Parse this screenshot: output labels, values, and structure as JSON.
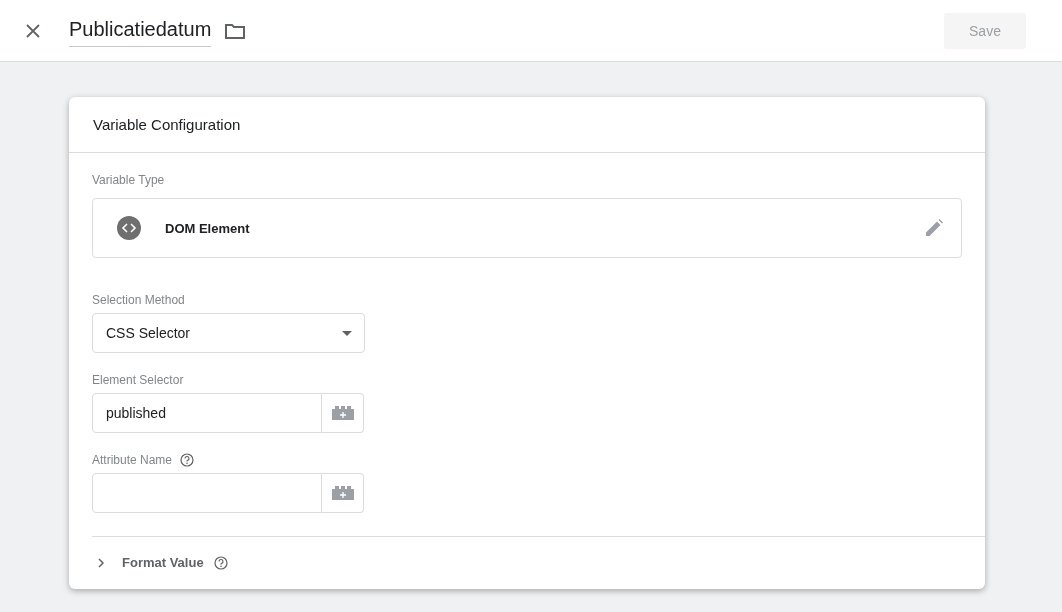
{
  "header": {
    "title": "Publicatiedatum",
    "save_button": {
      "label": "Save",
      "disabled": true
    }
  },
  "card": {
    "title": "Variable Configuration",
    "variable_type": {
      "label": "Variable Type",
      "value": "DOM Element"
    },
    "selection_method": {
      "label": "Selection Method",
      "value": "CSS Selector"
    },
    "fields": [
      {
        "label": "Element Selector",
        "value": "published",
        "help": false
      },
      {
        "label": "Attribute Name",
        "help": true
      }
    ],
    "format_value": {
      "label": "Format Value",
      "expanded": false,
      "help": true
    }
  }
}
